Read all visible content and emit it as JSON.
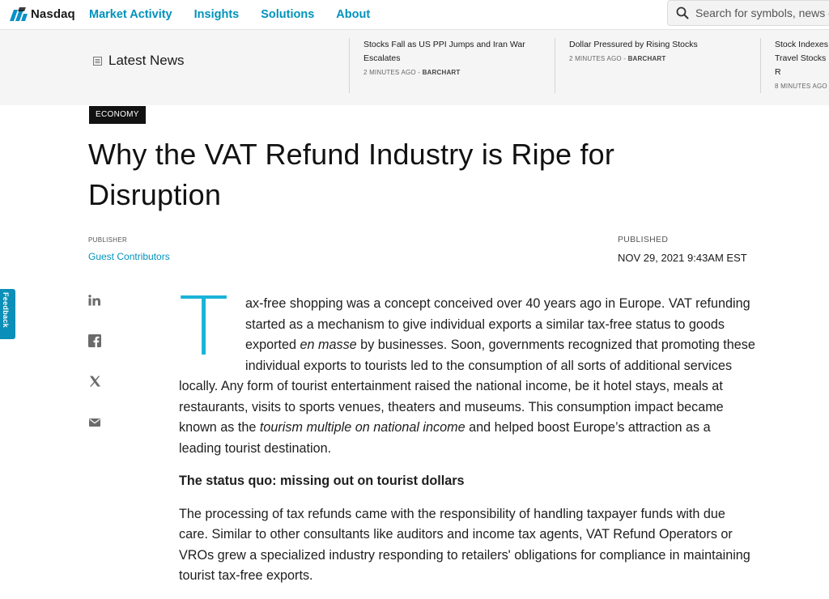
{
  "nav": {
    "logo": "Nasdaq",
    "links": [
      "Market Activity",
      "Insights",
      "Solutions",
      "About"
    ],
    "search_placeholder": "Search for symbols, news or products"
  },
  "latest_news": {
    "label": "Latest News",
    "items": [
      {
        "headline": "Stocks Fall as US PPI Jumps and Iran War Escalates",
        "time": "2 MINUTES AGO",
        "source": "BARCHART"
      },
      {
        "headline": "Dollar Pressured by Rising Stocks",
        "time": "2 MINUTES AGO",
        "source": "BARCHART"
      },
      {
        "headline": "Stock Indexes Travel Stocks R",
        "time": "8 MINUTES AGO",
        "source": ""
      }
    ]
  },
  "article": {
    "category": "ECONOMY",
    "title": "Why the VAT Refund Industry is Ripe for Disruption",
    "publisher_label": "PUBLISHER",
    "publisher": "Guest Contributors",
    "published_label": "PUBLISHED",
    "published": "NOV 29, 2021 9:43AM EST",
    "dropcap": "T",
    "p1_a": "ax-free shopping was a concept conceived over 40 years ago in Europe. VAT refunding started as a mechanism to give individual exports a similar tax-free status to goods exported ",
    "p1_em1": "en masse",
    "p1_b": " by businesses. Soon, governments recognized that promoting these individual exports to tourists led to the consumption of all sorts of additional services locally. Any form of tourist entertainment raised the national income, be it hotel stays, meals at restaurants, visits to sports venues, theaters and museums. This consumption impact became known as the ",
    "p1_em2": "tourism multiple on national income",
    "p1_c": " and helped boost Europe’s attraction as a leading tourist destination.",
    "subhead": "The status quo: missing out on tourist dollars",
    "p2": "The processing of tax refunds came with the responsibility of handling taxpayer funds with due care. Similar to other consultants like auditors and income tax agents, VAT Refund Operators or VROs grew a specialized industry responding to retailers' obligations for compliance in maintaining tourist tax-free exports."
  },
  "share_icons": [
    "linkedin-icon",
    "facebook-icon",
    "x-icon",
    "email-icon"
  ],
  "feedback_label": "Feedback",
  "colors": {
    "accent": "#0092bc",
    "dropcap": "#1ab3d6",
    "feedback": "#0b8fb8"
  }
}
